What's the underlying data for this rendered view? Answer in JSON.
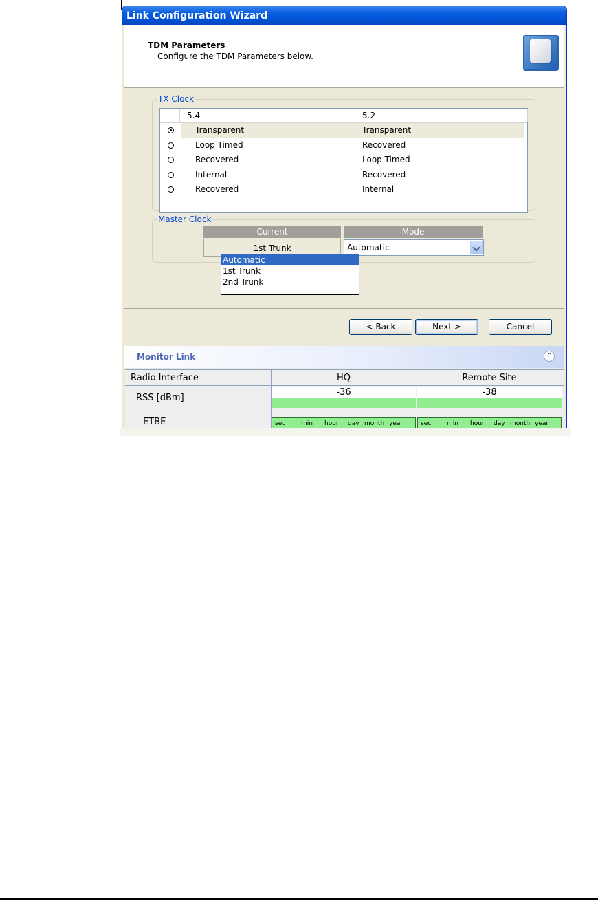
{
  "window": {
    "title": "Link Configuration Wizard"
  },
  "header": {
    "title": "TDM Parameters",
    "subtitle": "Configure the TDM Parameters below."
  },
  "tx_clock": {
    "legend": "TX Clock",
    "columns": [
      "5.4",
      "5.2"
    ],
    "rows": [
      {
        "site_a": "Transparent",
        "site_b": "Transparent",
        "selected": true
      },
      {
        "site_a": "Loop Timed",
        "site_b": "Recovered",
        "selected": false
      },
      {
        "site_a": "Recovered",
        "site_b": "Loop Timed",
        "selected": false
      },
      {
        "site_a": "Internal",
        "site_b": "Recovered",
        "selected": false
      },
      {
        "site_a": "Recovered",
        "site_b": "Internal",
        "selected": false
      }
    ]
  },
  "master_clock": {
    "legend": "Master Clock",
    "current_header": "Current",
    "mode_header": "Mode",
    "current_value": "1st Trunk",
    "mode_value": "Automatic",
    "options": [
      "Automatic",
      "1st Trunk",
      "2nd Trunk"
    ],
    "highlighted_option": "Automatic"
  },
  "buttons": {
    "back": "Back",
    "next": "Next",
    "cancel": "Cancel"
  },
  "monitor": {
    "title": "Monitor Link",
    "row_header": "Radio Interface",
    "hq_label": "HQ",
    "remote_label": "Remote Site",
    "rss_label": "RSS [dBm]",
    "hq_rss": "-36",
    "remote_rss": "-38",
    "etbe_label": "ETBE",
    "etbe_scale": [
      "sec",
      "min",
      "hour",
      "day",
      "month",
      "year"
    ]
  },
  "colors": {
    "title_bar": "#0a5ee0",
    "legend": "#0046d5",
    "selection": "#316ac5",
    "rss_bar": "#90ee90",
    "monitor_title": "#4b68b2"
  }
}
